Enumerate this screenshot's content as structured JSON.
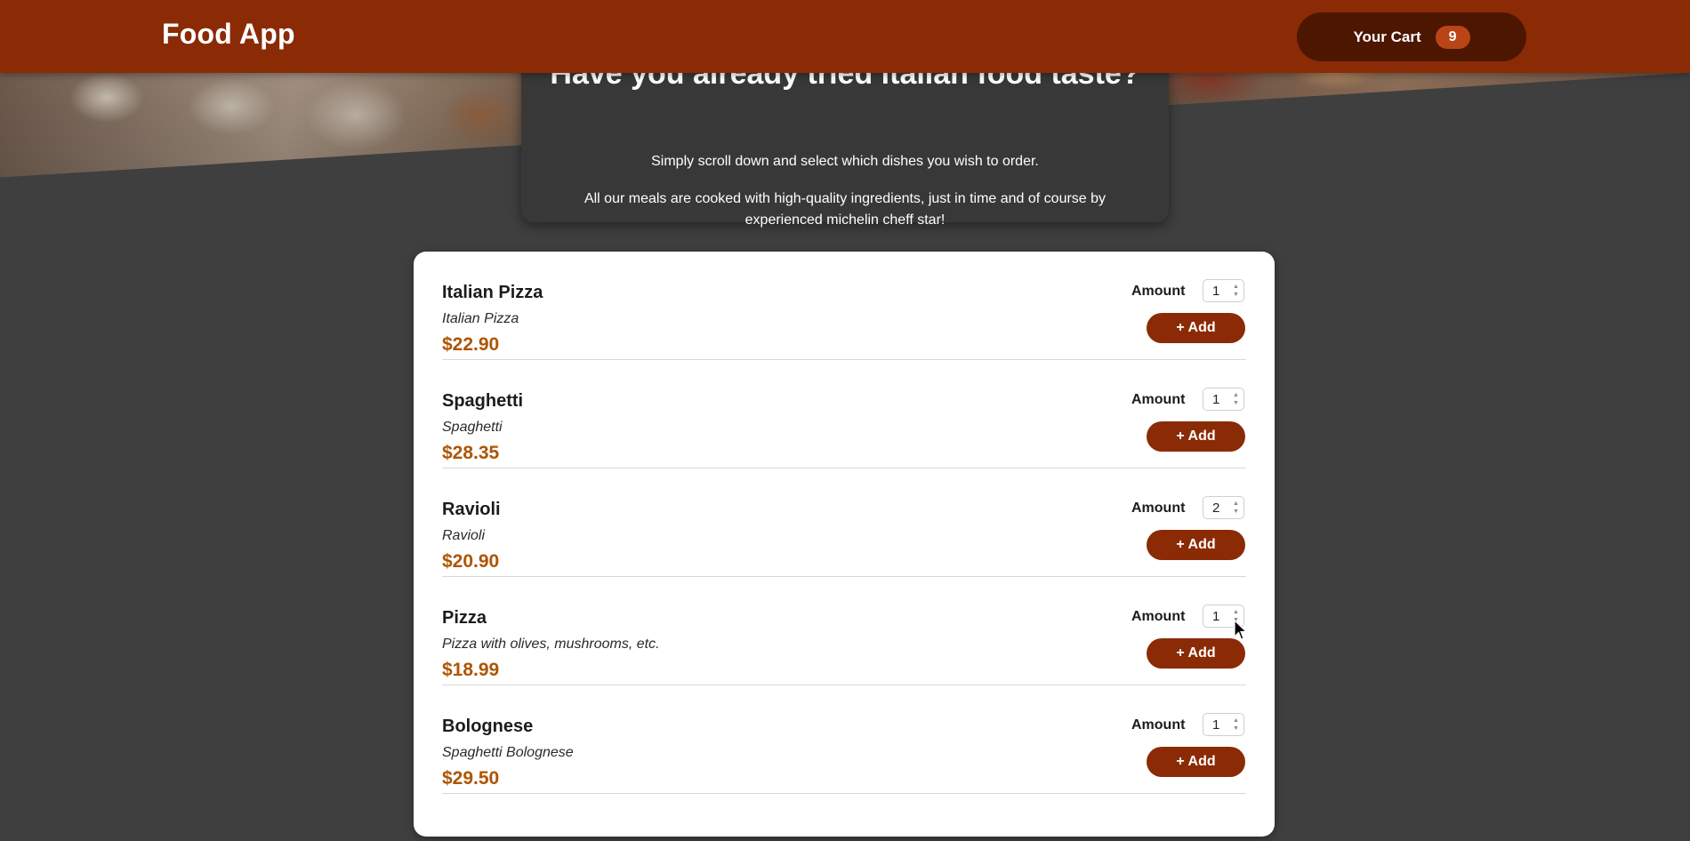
{
  "header": {
    "title": "Food App",
    "cart_label": "Your Cart",
    "cart_count": "9"
  },
  "summary": {
    "title": "Have you already tried italian food taste?",
    "line1": "Simply scroll down and select which dishes you wish to order.",
    "line2": "All our meals are cooked with high-quality ingredients, just in time and of course by experienced michelin cheff star!"
  },
  "meals": [
    {
      "name": "Italian Pizza",
      "description": "Italian Pizza",
      "price": "$22.90",
      "amount_label": "Amount",
      "amount": "1",
      "add_label": "+ Add"
    },
    {
      "name": "Spaghetti",
      "description": "Spaghetti",
      "price": "$28.35",
      "amount_label": "Amount",
      "amount": "1",
      "add_label": "+ Add"
    },
    {
      "name": "Ravioli",
      "description": "Ravioli",
      "price": "$20.90",
      "amount_label": "Amount",
      "amount": "2",
      "add_label": "+ Add"
    },
    {
      "name": "Pizza",
      "description": "Pizza with olives, mushrooms, etc.",
      "price": "$18.99",
      "amount_label": "Amount",
      "amount": "1",
      "add_label": "+ Add"
    },
    {
      "name": "Bolognese",
      "description": "Spaghetti Bolognese",
      "price": "$29.50",
      "amount_label": "Amount",
      "amount": "1",
      "add_label": "+ Add"
    }
  ],
  "icons": {
    "spinner": "number-spinner-icon",
    "cursor": "mouse-pointer-icon"
  },
  "colors": {
    "header": "#8a2b06",
    "cart_button": "#4d1601",
    "cart_badge": "#b94517",
    "price": "#ad5502",
    "background": "#3f3f3f"
  }
}
